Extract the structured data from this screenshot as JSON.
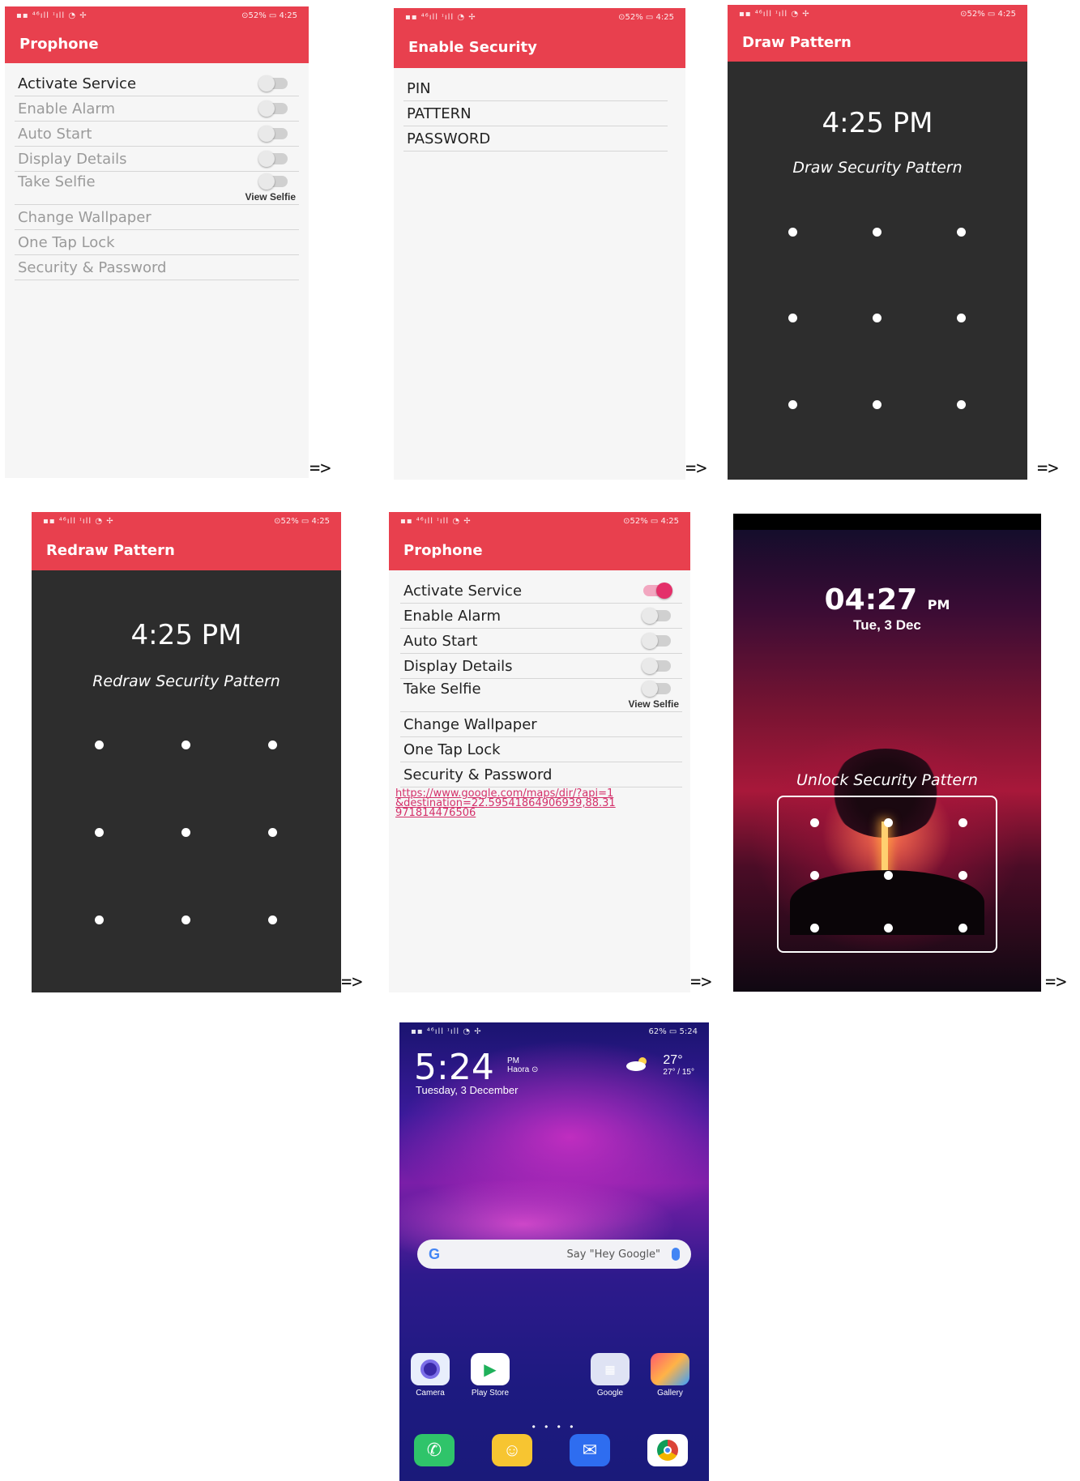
{
  "arrow": "=>",
  "statusbar": {
    "signal": "▪▪ ⁴⁶ıll ᶦıll ◔ ✢",
    "right": "⊙52% ▭ 4:25",
    "home_right": "62% ▭ 5:24"
  },
  "screen1": {
    "title": "Prophone",
    "items": [
      "Activate Service",
      "Enable Alarm",
      "Auto Start",
      "Display Details",
      "Take Selfie"
    ],
    "view_selfie": "View Selfie",
    "extra_items": [
      "Change Wallpaper",
      "One Tap Lock",
      "Security & Password"
    ]
  },
  "screen2": {
    "title": "Enable Security",
    "options": [
      "PIN",
      "PATTERN",
      "PASSWORD"
    ]
  },
  "screen3": {
    "title": "Draw Pattern",
    "time": "4:25 PM",
    "subtitle": "Draw Security Pattern"
  },
  "screen4": {
    "title": "Redraw Pattern",
    "time": "4:25 PM",
    "subtitle": "Redraw Security Pattern"
  },
  "screen5": {
    "title": "Prophone",
    "items": [
      "Activate Service",
      "Enable Alarm",
      "Auto Start",
      "Display Details",
      "Take Selfie"
    ],
    "active_index": 0,
    "view_selfie": "View Selfie",
    "extra_items": [
      "Change Wallpaper",
      "One Tap Lock",
      "Security & Password"
    ],
    "link": "https://www.google.com/maps/dir/?api=1&destination=22.59541864906939,88.31971814476506"
  },
  "screen6": {
    "time": "04:27",
    "ampm": "PM",
    "date": "Tue, 3 Dec",
    "subtitle": "Unlock Security Pattern"
  },
  "screen7": {
    "time": "5:24",
    "ampm": "PM",
    "location": "Haora ⊙",
    "date": "Tuesday, 3 December",
    "temp": "27°",
    "temp_range": "27° / 15°",
    "search_placeholder": "Say \"Hey Google\"",
    "apps": [
      "Camera",
      "Play Store",
      "Google",
      "Gallery"
    ],
    "pager": "• • • •"
  }
}
